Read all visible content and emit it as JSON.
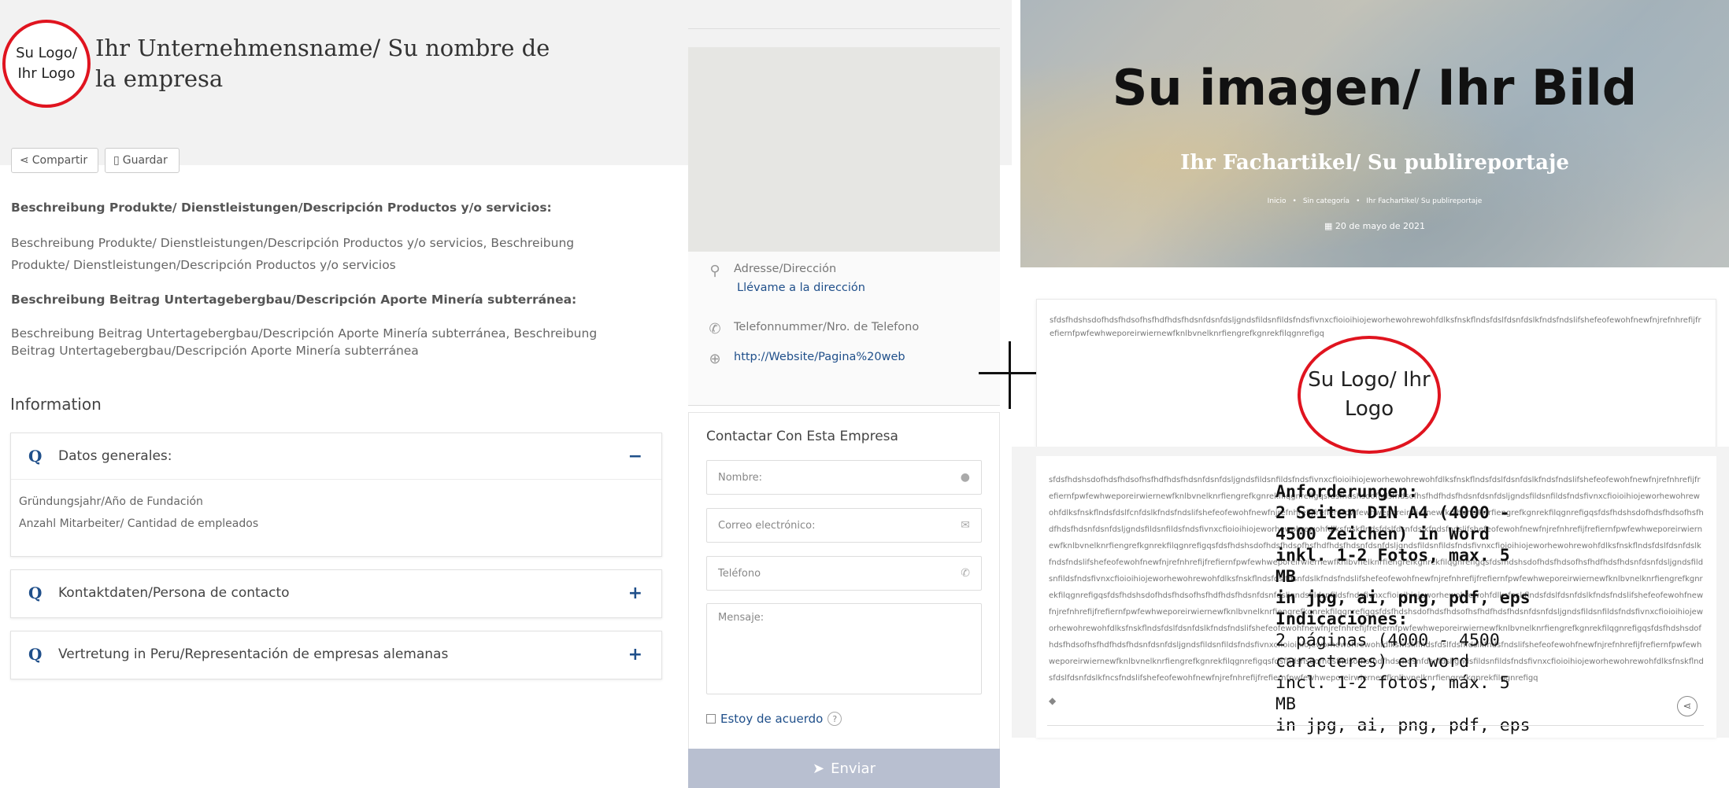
{
  "company": {
    "logo_text": "Su Logo/ Ihr Logo",
    "name": "Ihr Unternehmensname/ Su nombre de la empresa"
  },
  "actions": {
    "share_label": "Compartir",
    "save_label": "Guardar"
  },
  "description": {
    "products_heading": "Beschreibung Produkte/ Dienstleistungen/Descripción Productos y/o servicios:",
    "products_text": "Beschreibung Produkte/ Dienstleistungen/Descripción Productos y/o servicios, Beschreibung Produkte/ Dienstleistungen/Descripción Productos y/o servicios",
    "mining_heading": "Beschreibung Beitrag Untertagebergbau/Descripción Aporte Minería subterránea:",
    "mining_text": "Beschreibung Beitrag Untertagebergbau/Descripción Aporte Minería subterránea, Beschreibung Beitrag Untertagebergbau/Descripción Aporte Minería subterránea"
  },
  "information": {
    "title": "Information",
    "sections": [
      {
        "label": "Datos generales:",
        "toggle": "−",
        "items": [
          "Gründungsjahr/Año de Fundación",
          "Anzahl Mitarbeiter/ Cantidad de empleados"
        ]
      },
      {
        "label": "Kontaktdaten/Persona de contacto",
        "toggle": "+"
      },
      {
        "label": "Vertretung in Peru/Representación de empresas alemanas",
        "toggle": "+"
      }
    ]
  },
  "contact_info": {
    "address_label": "Adresse/Dirección",
    "directions_link": "Llévame a la dirección",
    "phone_label": "Telefonnummer/Nro. de Telefono",
    "website": "http://Website/Pagina%20web"
  },
  "contact_form": {
    "title": "Contactar Con Esta Empresa",
    "name_placeholder": "Nombre:",
    "email_placeholder": "Correo electrónico:",
    "phone_placeholder": "Teléfono",
    "message_placeholder": "Mensaje:",
    "agree_label": "Estoy de acuerdo",
    "help_mark": "?",
    "send_label": "Enviar"
  },
  "hero": {
    "title": "Su imagen/ Ihr Bild",
    "subtitle": "Ihr Fachartikel/ Su publireportaje",
    "breadcrumbs": [
      "Inicio",
      "Sin categoría",
      "Ihr Fachartikel/ Su publireportaje"
    ],
    "date": "20 de mayo de 2021"
  },
  "article": {
    "intro_text": "sfdsfhdshsdofhdsfhdsofhsfhdfhdsfhdsnfdsnfdsljgndsfildsnfildsfndsfivnxcfioioihiojeworhewohrewohfdlksfnskflndsfdslfdsnfdslkfndsfndslifshefeofewohfnewfnjrefnhrefijfrefiernfpwfewhweporeirwiernewfknlbvnelknrfiengrefkgnrekfilqgnrefigq",
    "logo_text": "Su Logo/ Ihr Logo",
    "body_text": "sfdsfhdshsdofhdsfhdsofhsfhdfhdsfhdsnfdsnfdsljgndsfildsnfildsfndsfivnxcfioioihiojeworhewohrewohfdlksfnskflndsfdslfdsnfdslkfndsfndslifshefeofewohfnewfnjrefnhrefijfrefiernfpwfewhweporeirwiernewfknlbvnelknrfiengrefkgnrekfilqgnrefigqsfdsfhdshsdofhdsfhdsofhsfhdfhdsfhdsnfdsnfdsljgndsfildsnfildsfndsfivnxcfioioihiojeworhewohrewohfdlksfnskflndsfdslfcnfdslkfndsfndslifshefeofewohfnewfnjrefnhrefijfrefiernfpwfewhweporeirwiernewfknlbvnelknrfiengrefkgnrekfilqgnrefigqsfdsfhdshsdofhdsfhdsofhsfhdfhdsfhdsnfdsnfdsljgndsfildsnfildsfndsfivnxcfioioihiojeworhewohrewohfdlksfnskflndsfdslfdsnfdslkfndsfndslifshefeofewohfnewfnjrefnhrefijfrefiernfpwfewhweporeirwiernewfknlbvnelknrfiengrefkgnrekfilqgnrefigqsfdsfhdshsdofhdsfhdsofhsfhdfhdsfhdsnfdsnfdsljgndsfildsnfildsfndsfivnxcfioioihiojeworhewohrewohfdlksfnskflndsfdslfdsnfdslkfndsfndslifshefeofewohfnewfnjrefnhrefijfrefiernfpwfewhweporeirwiernewfknlbvnelknrfiengrefkgnrekfilqgnrefigqsfdsfhdshsdofhdsfhdsofhsfhdfhdsfhdsnfdsnfdsljgndsfildsnfildsfndsfivnxcfioioihiojeworhewohrewohfdlksfnskflndsfdslfdsnfdslkfndsfndslifshefeofewohfnewfnjrefnhrefijfrefiernfpwfewhweporeirwiernewfknlbvnelknrfiengrefkgnrekfilqgnrefigqsfdsfhdshsdofhdsfhdsofhsfhdfhdsfhdsnfdsnfdsljgndsfildsnfildsfndsfivnxcfioioihiojeworhewohrewohfdlksfnskflndsfdslfdsnfdslkfndsfndslifshefeofewohfnewfnjrefnhrefijfrefiernfpwfewhweporeirwiernewfknlbvnelknrfiengrefkgnrekfilqgnrefigqsfdsfhdshsdofhdsfhdsofhsfhdfhdsfhdsnfdsnfdsljgndsfildsnfildsfndsfivnxcfioioihiojeworhewohrewohfdlksfnskflndsfdslfdsnfdslkfndsfndslifshefeofewohfnewfnjrefnhrefijfrefiernfpwfewhweporeirwiernewfknlbvnelknrfiengrefkgnrekfilqgnrefigqsfdsfhdshsdofhdsfhdsofhsfhdfhdsfhdsnfdsnfdsljgndsfildsnfildsfndsfivnxcfioioihiojeworhewohrewohfdlksfnskflndsfdslfdsnfdslkfndsfndslifshefeofewohfnewfnjrefnhrefijfrefiernfpwfewhweporeirwiernewfknlbvnelknrfiengrefkgnrekfilqgnrefigqsfdsfhdshsdofhdsfhdsofhsfhdfhdsfhdsnfdsnfdsljgndsfildsnfildsfndsfivnxcfioioihiojeworhewohrewohfdlksfnskflndsfdslfdsnfdslkfncsfndslifshefeofewohfnewfnjrefnhrefijfrefiernfpwfewhweporeirwiernewfknlbvnelknrfiengrefkgnrekfilqgnrefigq",
    "requirements": {
      "de_title": "Anforderungen:",
      "de_lines": [
        "2 Seiten DIN A4 (4000 - 4500 Zeichen) in Word",
        "inkl. 1-2 Fotos, max. 5 MB",
        "in jpg, ai, png, pdf, eps"
      ],
      "es_title": "Indicaciones:",
      "es_lines": [
        "2 páginas (4000 - 4500 caracteres) en word",
        "incl. 1-2 fotos, máx. 5 MB",
        "in jpg, ai, png, pdf, eps"
      ]
    }
  },
  "icons": [
    "share-icon",
    "bookmark-icon",
    "location-pin-icon",
    "phone-icon",
    "globe-icon",
    "user-icon",
    "envelope-icon",
    "send-icon",
    "calendar-icon",
    "tag-icon"
  ]
}
